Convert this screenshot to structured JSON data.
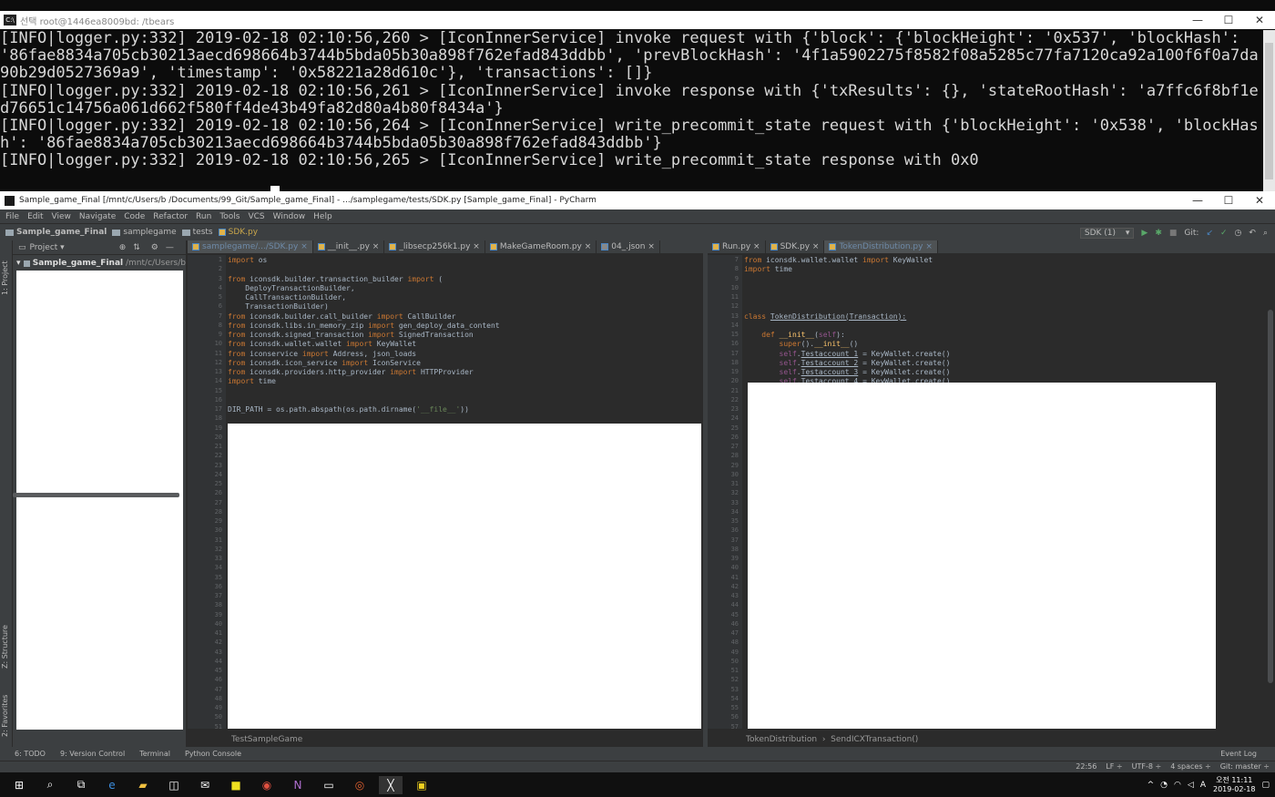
{
  "terminal": {
    "title": "선택 root@1446ea8009bd: /tbears",
    "lines": [
      "[INFO|logger.py:332] 2019-02-18 02:10:56,260 > [IconInnerService] invoke request with {'block': {'blockHeight': '0x537', 'blockHash': '86fae8834a705cb30213aecd698664b3744b5bda05b30a898f762efad843ddbb', 'prevBlockHash': '4f1a5902275f8582f08a5285c77fa7120ca92a100f6f0a7da90b29d0527369a9', 'timestamp': '0x58221a28d610c'}, 'transactions': []}",
      "[INFO|logger.py:332] 2019-02-18 02:10:56,261 > [IconInnerService] invoke response with {'txResults': {}, 'stateRootHash': 'a7ffc6f8bf1ed76651c14756a061d662f580ff4de43b49fa82d80a4b80f8434a'}",
      "[INFO|logger.py:332] 2019-02-18 02:10:56,264 > [IconInnerService] write_precommit_state request with {'blockHeight': '0x538', 'blockHash': '86fae8834a705cb30213aecd698664b3744b5bda05b30a898f762efad843ddbb'}",
      "[INFO|logger.py:332] 2019-02-18 02:10:56,265 > [IconInnerService] write_precommit_state response with 0x0"
    ]
  },
  "ide": {
    "title": "Sample_game_Final [/mnt/c/Users/b       /Documents/99_Git/Sample_game_Final] - .../samplegame/tests/SDK.py [Sample_game_Final] - PyCharm",
    "menu": [
      "File",
      "Edit",
      "View",
      "Navigate",
      "Code",
      "Refactor",
      "Run",
      "Tools",
      "VCS",
      "Window",
      "Help"
    ],
    "breadcrumbs": [
      "Sample_game_Final",
      "samplegame",
      "tests",
      "SDK.py"
    ],
    "run_config": "SDK (1)",
    "git_label": "Git:",
    "project_label": "Project",
    "project_root": "Sample_game_Final",
    "project_root_path": "/mnt/c/Users/b",
    "side_project": "1: Project",
    "side_structure": "Z: Structure",
    "side_favorites": "2: Favorites",
    "left_tabs": [
      "samplegame/.../SDK.py",
      "__init__.py",
      "_libsecp256k1.py",
      "MakeGameRoom.py",
      "04_.json"
    ],
    "right_tabs": [
      "Run.py",
      "SDK.py",
      "TokenDistribution.py"
    ],
    "left_breadcrumb": "TestSampleGame",
    "right_breadcrumb": [
      "TokenDistribution",
      "SendICXTransaction()"
    ],
    "tool_windows": [
      "6: TODO",
      "9: Version Control",
      "Terminal",
      "Python Console"
    ],
    "event_log": "Event Log",
    "status": {
      "position": "22:56",
      "line_sep": "LF ÷",
      "encoding": "UTF-8 ÷",
      "indent": "4 spaces ÷",
      "git": "Git: master ÷"
    }
  },
  "taskbar": {
    "time": "오전 11:11",
    "date": "2019-02-18"
  }
}
